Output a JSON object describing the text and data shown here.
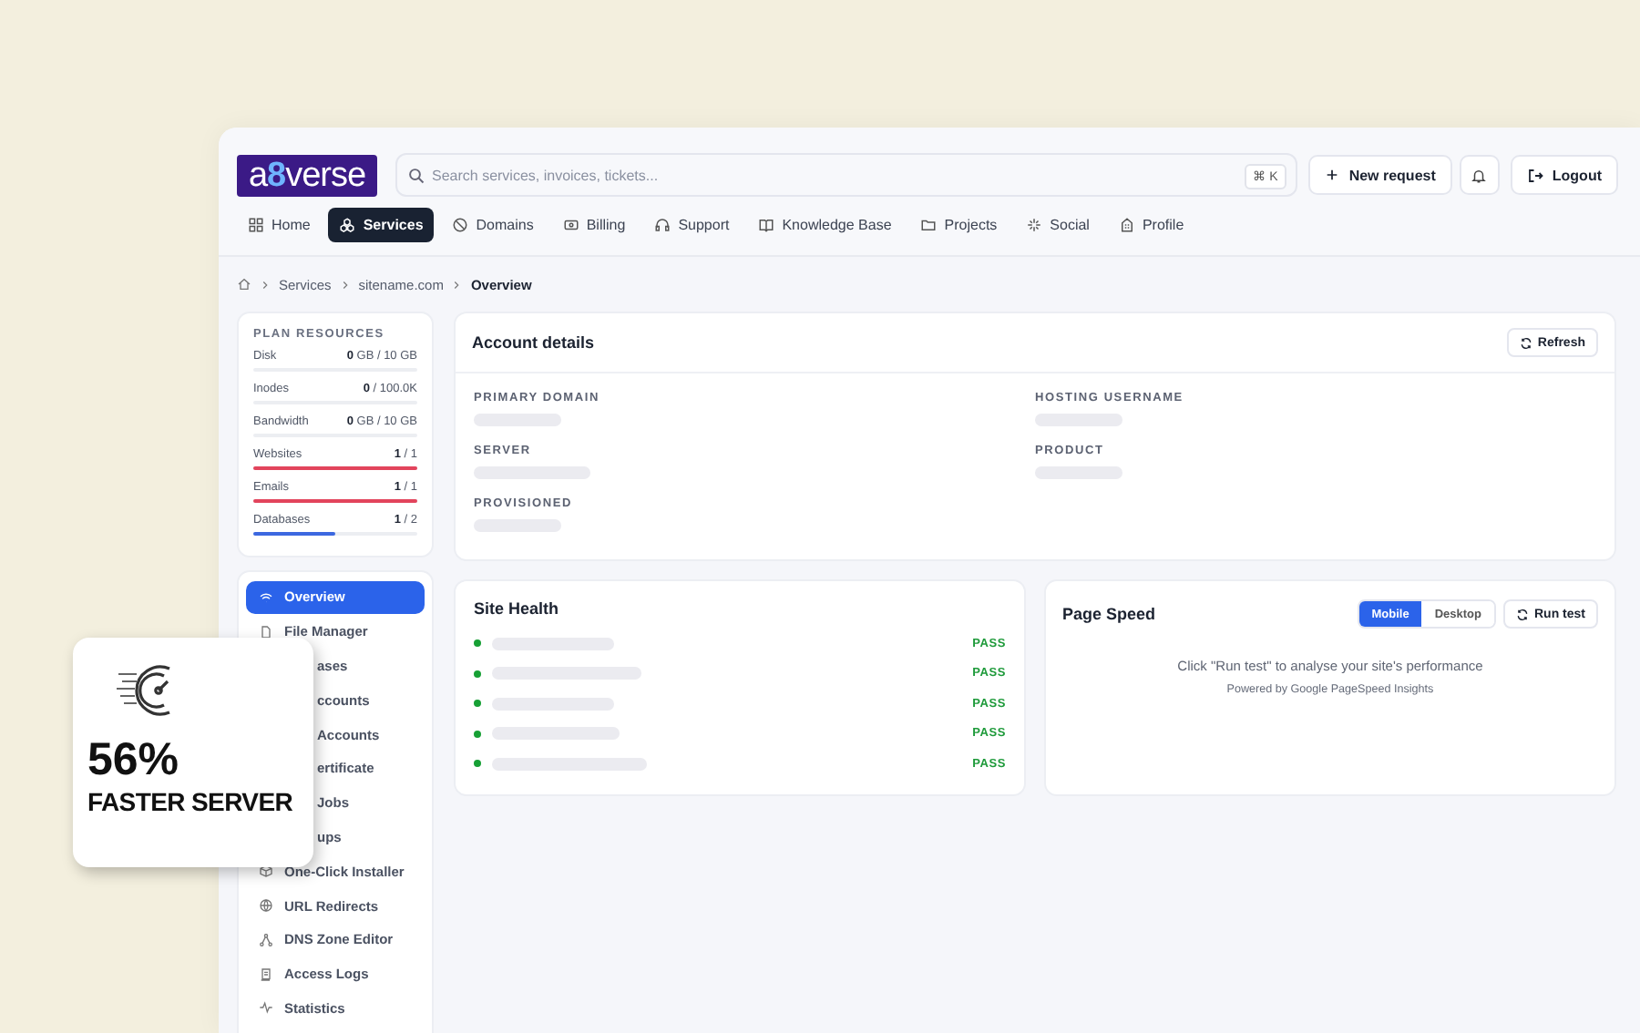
{
  "header": {
    "logo": {
      "prefix": "a",
      "mark": "8",
      "suffix": "verse"
    },
    "search": {
      "placeholder": "Search services, invoices, tickets...",
      "shortcut": "⌘ K"
    },
    "new_request": "New request",
    "logout": "Logout"
  },
  "tabs": [
    {
      "label": "Home",
      "selected": false
    },
    {
      "label": "Services",
      "selected": true
    },
    {
      "label": "Domains",
      "selected": false
    },
    {
      "label": "Billing",
      "selected": false
    },
    {
      "label": "Support",
      "selected": false
    },
    {
      "label": "Knowledge Base",
      "selected": false
    },
    {
      "label": "Projects",
      "selected": false
    },
    {
      "label": "Social",
      "selected": false
    },
    {
      "label": "Profile",
      "selected": false
    }
  ],
  "breadcrumb": [
    "Services",
    "sitename.com",
    "Overview"
  ],
  "plan_resources": {
    "title": "PLAN RESOURCES",
    "items": [
      {
        "name": "Disk",
        "value": "**0** GB / 10 GB",
        "level": 0
      },
      {
        "name": "Inodes",
        "value": "**0** / 100.0K",
        "level": 0
      },
      {
        "name": "Bandwidth",
        "value": "**0** GB / 10 GB",
        "level": 0
      },
      {
        "name": "Websites",
        "value": "**1** / 1",
        "level": 1
      },
      {
        "name": "Emails",
        "value": "**1** / 1",
        "level": 1
      },
      {
        "name": "Databases",
        "value": "**1** / 2",
        "level": 0.5
      }
    ]
  },
  "sidebar": {
    "items": [
      {
        "label": "Overview",
        "selected": true,
        "kind": "full"
      },
      {
        "label": "File Manager",
        "selected": false,
        "kind": "full"
      },
      {
        "label": "ases",
        "selected": false,
        "kind": "covered"
      },
      {
        "label": "ccounts",
        "selected": false,
        "kind": "covered"
      },
      {
        "label": "Accounts",
        "selected": false,
        "kind": "covered"
      },
      {
        "label": "ertificate",
        "selected": false,
        "kind": "covered"
      },
      {
        "label": "Jobs",
        "selected": false,
        "kind": "covered"
      },
      {
        "label": "ups",
        "selected": false,
        "kind": "covered"
      },
      {
        "label": "One-Click Installer",
        "selected": false,
        "kind": "full"
      },
      {
        "label": "URL Redirects",
        "selected": false,
        "kind": "full"
      },
      {
        "label": "DNS Zone Editor",
        "selected": false,
        "kind": "full"
      },
      {
        "label": "Access Logs",
        "selected": false,
        "kind": "full"
      },
      {
        "label": "Statistics",
        "selected": false,
        "kind": "full"
      }
    ]
  },
  "account_details": {
    "title": "Account details",
    "refresh": "Refresh",
    "fields": [
      {
        "label": "PRIMARY DOMAIN"
      },
      {
        "label": "HOSTING USERNAME"
      },
      {
        "label": "SERVER"
      },
      {
        "label": "PRODUCT"
      },
      {
        "label": "PROVISIONED"
      }
    ]
  },
  "site_health": {
    "title": "Site Health",
    "checks": [
      {
        "status": "PASS"
      },
      {
        "status": "PASS"
      },
      {
        "status": "PASS"
      },
      {
        "status": "PASS"
      },
      {
        "status": "PASS"
      }
    ]
  },
  "page_speed": {
    "title": "Page Speed",
    "modes": [
      {
        "label": "Mobile",
        "selected": true
      },
      {
        "label": "Desktop",
        "selected": false
      }
    ],
    "run": "Run test",
    "message": "Click \"Run test\" to analyse your site's performance",
    "powered_by": "Powered by Google PageSpeed Insights"
  },
  "promo": {
    "value": "56%",
    "caption": "FASTER SERVER"
  }
}
